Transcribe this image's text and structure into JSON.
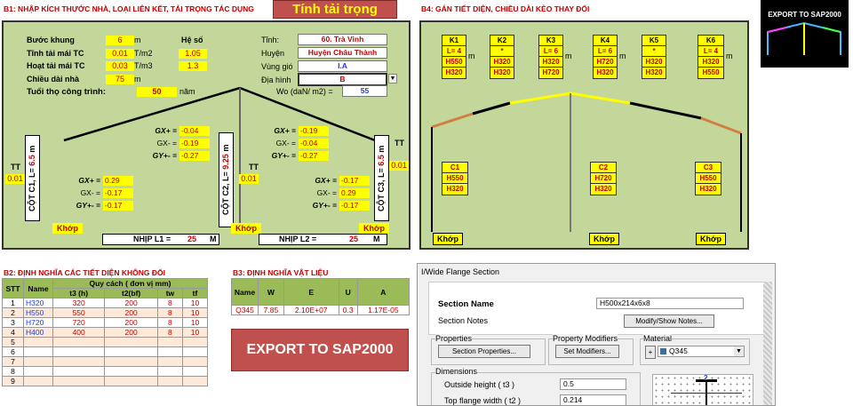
{
  "b1": {
    "title": "B1: NHẬP KÍCH THƯỚC NHÀ, LOẠI LIÊN KẾT, TẢI TRỌNG TÁC DỤNG",
    "calc_button": "Tính tải trọng",
    "inputs": [
      {
        "label": "Bước khung",
        "value": "6",
        "unit": "m"
      },
      {
        "label": "Tĩnh tải mái TC",
        "value": "0.01",
        "unit": "T/m2"
      },
      {
        "label": "Hoạt tải mái TC",
        "value": "0.03",
        "unit": "T/m3"
      },
      {
        "label": "Chiều dài nhà",
        "value": "75",
        "unit": "m"
      },
      {
        "label": "Tuổi thọ công trình:",
        "value": "50",
        "unit": "năm"
      }
    ],
    "he_so_label": "Hệ số",
    "he_so": [
      "1.05",
      "1.3"
    ],
    "location": [
      {
        "label": "Tỉnh:",
        "value": "60. Trà Vinh"
      },
      {
        "label": "Huyện",
        "value": "Huyện Châu Thành"
      },
      {
        "label": "Vùng gió",
        "value": "I.A"
      },
      {
        "label": "Địa hình",
        "value": "B"
      }
    ],
    "wo_label": "Wo (daN/ m2) =",
    "wo_value": "55",
    "frame": {
      "left_top": [
        {
          "k": "GX+ =",
          "v": "-0.04"
        },
        {
          "k": "GX- =",
          "v": "-0.19"
        },
        {
          "k": "GY+- =",
          "v": "-0.27"
        }
      ],
      "left_bot": [
        {
          "k": "GX+ =",
          "v": "0.29"
        },
        {
          "k": "GX- =",
          "v": "-0.17"
        },
        {
          "k": "GY+- =",
          "v": "-0.17"
        }
      ],
      "right_top": [
        {
          "k": "GX+ =",
          "v": "-0.19"
        },
        {
          "k": "GX- =",
          "v": "-0.04"
        },
        {
          "k": "GY+- =",
          "v": "-0.27"
        }
      ],
      "right_bot": [
        {
          "k": "GX+ =",
          "v": "-0.17"
        },
        {
          "k": "GX- =",
          "v": "0.29"
        },
        {
          "k": "GY+- =",
          "v": "-0.17"
        }
      ],
      "col1": "CỘT C1, L=",
      "col1_len": "6.5",
      "col1_unit": "m",
      "col2": "CỘT C2, L=",
      "col2_len": "9.25",
      "col2_unit": "m",
      "col3": "CỘT C3, L=",
      "col3_len": "6.5",
      "col3_unit": "m",
      "tt_label": "TT",
      "tt_left": "0.01",
      "tt_mid": "0.01",
      "tt_right": "0.01",
      "khop": "Khớp",
      "nhip1_label": "NHỊP L1 =",
      "nhip1": "25",
      "nhip1_unit": "M",
      "nhip2_label": "NHỊP L2 =",
      "nhip2": "25",
      "nhip2_unit": "M"
    }
  },
  "b4": {
    "title": "B4: GÁN TIẾT DIỆN, CHIỀU DÀI KÈO THAY ĐỔI",
    "rafters": [
      {
        "name": "K1",
        "l": "L= 4",
        "s1": "H550",
        "s2": "H320"
      },
      {
        "name": "K2",
        "l": "*",
        "s1": "H320",
        "s2": "H320"
      },
      {
        "name": "K3",
        "l": "L= 6",
        "s1": "H320",
        "s2": "H720"
      },
      {
        "name": "K4",
        "l": "L= 6",
        "s1": "H720",
        "s2": "H320"
      },
      {
        "name": "K5",
        "l": "*",
        "s1": "H320",
        "s2": "H320"
      },
      {
        "name": "K6",
        "l": "L= 4",
        "s1": "H320",
        "s2": "H550"
      }
    ],
    "unit": "m",
    "cols": [
      {
        "name": "C1",
        "s1": "H550",
        "s2": "H320"
      },
      {
        "name": "C2",
        "s1": "H720",
        "s2": "H320"
      },
      {
        "name": "C3",
        "s1": "H550",
        "s2": "H320"
      }
    ],
    "khop": "Khớp"
  },
  "logo_text": "EXPORT TO SAP2000",
  "b2": {
    "title": "B2: ĐỊNH NGHĨA CÁC TIẾT DIỆN KHÔNG ĐỔI",
    "header_main": [
      "STT",
      "Name",
      "Quy cách ( đơn vị mm)"
    ],
    "header_sub": [
      "t3 (h)",
      "t2(bf)",
      "tw",
      "tf"
    ],
    "rows": [
      [
        "1",
        "H320",
        "320",
        "200",
        "8",
        "10"
      ],
      [
        "2",
        "H550",
        "550",
        "200",
        "8",
        "10"
      ],
      [
        "3",
        "H720",
        "720",
        "200",
        "8",
        "10"
      ],
      [
        "4",
        "H400",
        "400",
        "200",
        "8",
        "10"
      ],
      [
        "5",
        "",
        "",
        "",
        "",
        ""
      ],
      [
        "6",
        "",
        "",
        "",
        "",
        ""
      ],
      [
        "7",
        "",
        "",
        "",
        "",
        ""
      ],
      [
        "8",
        "",
        "",
        "",
        "",
        ""
      ],
      [
        "9",
        "",
        "",
        "",
        "",
        ""
      ]
    ]
  },
  "b3": {
    "title": "B3: ĐỊNH NGHĨA VẬT LIỆU",
    "headers": [
      "Name",
      "W",
      "E",
      "U",
      "A"
    ],
    "row": [
      "Q345",
      "7.85",
      "2.10E+07",
      "0.3",
      "1.17E-05"
    ]
  },
  "export_button": "EXPORT TO SAP2000",
  "dialog": {
    "title": "I/Wide Flange Section",
    "section_name_label": "Section Name",
    "section_name": "H500x214x6x8",
    "section_notes_label": "Section Notes",
    "modify_notes": "Modify/Show Notes...",
    "properties_group": "Properties",
    "section_properties": "Section Properties...",
    "modifiers_group": "Property Modifiers",
    "set_modifiers": "Set Modifiers...",
    "material_group": "Material",
    "material_plus": "+",
    "material": "Q345",
    "dimensions_group": "Dimensions",
    "outside_height_label": "Outside height ( t3 )",
    "outside_height": "0.5",
    "top_flange_label": "Top flange width ( t2 )",
    "top_flange": "0.214",
    "axis_label": "2"
  }
}
